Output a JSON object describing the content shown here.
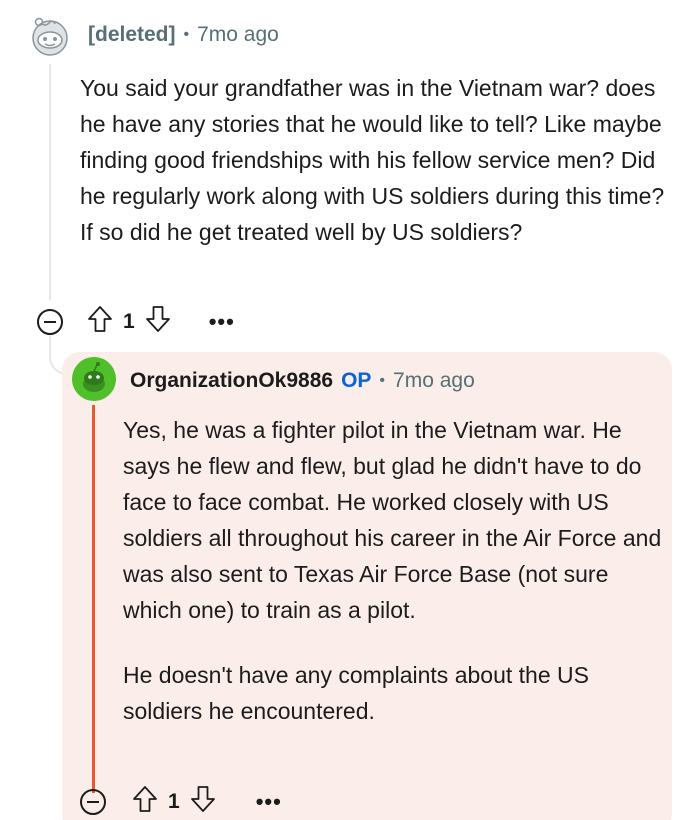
{
  "comment1": {
    "author": "[deleted]",
    "separator": "•",
    "time": "7mo ago",
    "body": "You said your grandfather was in the Vietnam war? does he have any stories that he would like to tell? Like maybe finding good friendships with his fellow service men? Did he regularly work along with US soldiers during this time? If so did he get treated well by US soldiers?",
    "votes": "1",
    "more": "•••"
  },
  "comment2": {
    "author": "OrganizationOk9886",
    "op_badge": "OP",
    "separator": "•",
    "time": "7mo ago",
    "paragraphs": [
      "Yes, he was a fighter pilot in the Vietnam war. He says he flew and flew, but glad he didn't have to do face to face combat. He worked closely with US soldiers all throughout his career in the Air Force and was also sent to Texas Air Force Base (not sure which one) to train as a pilot.",
      "He doesn't have any complaints about the US soldiers he encountered."
    ],
    "votes": "1",
    "more": "•••"
  },
  "colors": {
    "meta_gray": "#576f76",
    "op_blue": "#0a64d8",
    "reply_bg": "#fbeeea",
    "reply_accent": "#e35b2b",
    "avatar_green": "#4fbf2a"
  },
  "icons": [
    "deleted-user-avatar-icon",
    "snoo-avatar-icon",
    "collapse-icon",
    "upvote-icon",
    "downvote-icon",
    "more-options-icon"
  ]
}
